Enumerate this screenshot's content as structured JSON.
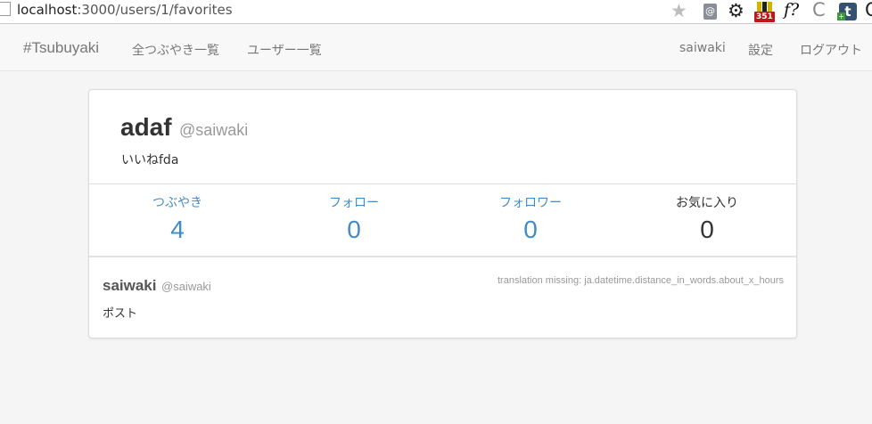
{
  "browser": {
    "url_host": "localhost",
    "url_path": ":3000/users/1/favorites",
    "extensions": [
      {
        "name": "doc-at-icon",
        "label": "@"
      },
      {
        "name": "gear-icon",
        "label": "⚙"
      },
      {
        "name": "bars-icon",
        "badge": "351"
      },
      {
        "name": "font-icon",
        "label": "f?"
      },
      {
        "name": "refresh-icon",
        "label": "C"
      },
      {
        "name": "tumblr-icon",
        "label": "t"
      }
    ]
  },
  "nav": {
    "brand": "#Tsubuyaki",
    "all_tweets": "全つぶやき一覧",
    "users": "ユーザー一覧",
    "current_user": "saiwaki",
    "settings": "設定",
    "logout": "ログアウト"
  },
  "profile": {
    "name": "adaf",
    "handle": "@saiwaki",
    "bio": "いいねfda",
    "stats": {
      "tweets": {
        "label": "つぶやき",
        "value": "4"
      },
      "following": {
        "label": "フォロー",
        "value": "0"
      },
      "followers": {
        "label": "フォロワー",
        "value": "0"
      },
      "favorites": {
        "label": "お気に入り",
        "value": "0"
      }
    }
  },
  "favorites": [
    {
      "author": "saiwaki",
      "handle": "@saiwaki",
      "time": "translation missing: ja.datetime.distance_in_words.about_x_hours",
      "body": "ポスト"
    }
  ],
  "colors": {
    "link": "#428bca",
    "text": "#333333",
    "muted": "#999999",
    "navbar_bg": "#f8f8f8",
    "page_bg": "#f5f5f5"
  }
}
